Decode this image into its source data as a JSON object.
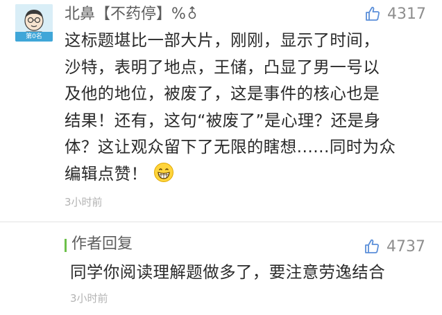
{
  "comment": {
    "avatar_badge": "第0名",
    "username": "北鼻【不药停】%",
    "username_icon": "gender-icon",
    "likes": "4317",
    "lines": [
      "这标题堪比一部大片，刚刚，显示了时间，",
      "沙特，表明了地点，王储，凸显了男一号以",
      "及他的地位，被废了，这是事件的核心也是",
      "结果！还有，这句“被废了”是心理？还是身",
      "体？这让观众留下了无限的瞎想......同时为众",
      "编辑点赞！"
    ],
    "emoji": "grinning-emoji",
    "time": "3小时前"
  },
  "reply": {
    "label": "作者回复",
    "likes": "4737",
    "text": "同学你阅读理解题做多了，要注意劳逸结合",
    "time": "3小时前"
  },
  "colors": {
    "accent_green": "#6cc04a",
    "badge_blue": "#3fa6d8",
    "muted": "#8e8e8e",
    "timestamp": "#b3b3b3"
  }
}
